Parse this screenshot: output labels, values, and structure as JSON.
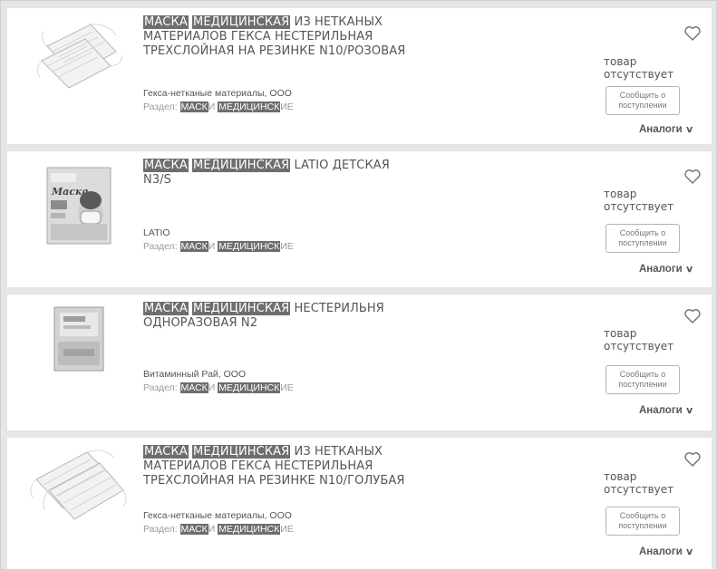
{
  "products": [
    {
      "hl1": "МАСКА",
      "hl2": "МЕДИЦИНСКАЯ",
      "title_rest": " ИЗ НЕТКАНЫХ МАТЕРИАЛОВ ГЕКСА НЕСТЕРИЛЬНАЯ ТРЕХСЛОЙНАЯ НА РЕЗИНКЕ N10/РОЗОВАЯ",
      "maker": "Гекса-нетканые материалы, ООО",
      "section_label": "Раздел:",
      "section_hl1": "МАСК",
      "section_mid": "И",
      "section_hl2": "МЕДИЦИНСК",
      "section_end": "ИЕ",
      "status": "товар отсутствует",
      "notify": "Сообщить о поступлении",
      "analogs": "Аналоги",
      "image_icon": "mask-pack-image",
      "favorite_icon": "heart-icon"
    },
    {
      "hl1": "МАСКА",
      "hl2": "МЕДИЦИНСКАЯ",
      "title_rest": " LATIO ДЕТСКАЯ N3/S",
      "maker": "LATIO",
      "section_label": "Раздел:",
      "section_hl1": "МАСК",
      "section_mid": "И",
      "section_hl2": "МЕДИЦИНСК",
      "section_end": "ИЕ",
      "status": "товар отсутствует",
      "notify": "Сообщить о поступлении",
      "analogs": "Аналоги",
      "box_text": "Маска",
      "image_icon": "mask-box-image",
      "favorite_icon": "heart-icon"
    },
    {
      "hl1": "МАСКА",
      "hl2": "МЕДИЦИНСКАЯ",
      "title_rest": " НЕСТЕРИЛЬНЯ ОДНОРАЗОВАЯ N2",
      "maker": "Витаминный Рай, ООО",
      "section_label": "Раздел:",
      "section_hl1": "МАСК",
      "section_mid": "И",
      "section_hl2": "МЕДИЦИНСК",
      "section_end": "ИЕ",
      "status": "товар отсутствует",
      "notify": "Сообщить о поступлении",
      "analogs": "Аналоги",
      "image_icon": "mask-packet-image",
      "favorite_icon": "heart-icon"
    },
    {
      "hl1": "МАСКА",
      "hl2": "МЕДИЦИНСКАЯ",
      "title_rest": " ИЗ НЕТКАНЫХ МАТЕРИАЛОВ ГЕКСА НЕСТЕРИЛЬНАЯ ТРЕХСЛОЙНАЯ НА РЕЗИНКЕ N10/ГОЛУБАЯ",
      "maker": "Гекса-нетканые материалы, ООО",
      "section_label": "Раздел:",
      "section_hl1": "МАСК",
      "section_mid": "И",
      "section_hl2": "МЕДИЦИНСК",
      "section_end": "ИЕ",
      "status": "товар отсутствует",
      "notify": "Сообщить о поступлении",
      "analogs": "Аналоги",
      "image_icon": "mask-pack-image",
      "favorite_icon": "heart-icon"
    }
  ]
}
